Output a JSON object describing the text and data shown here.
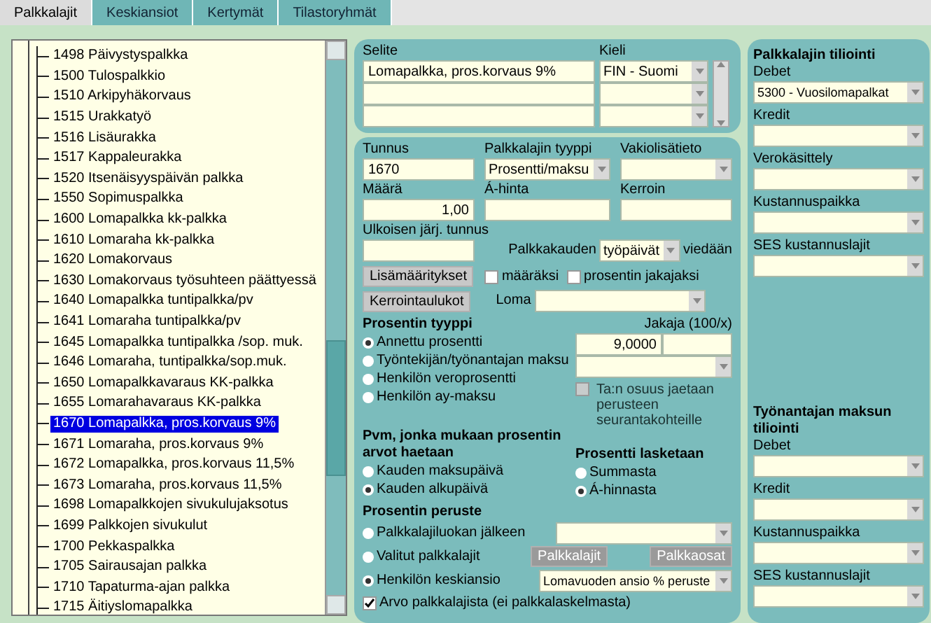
{
  "tabs": [
    {
      "label": "Palkkalajit",
      "selected": true
    },
    {
      "label": "Keskiansiot",
      "selected": false
    },
    {
      "label": "Kertymät",
      "selected": false
    },
    {
      "label": "Tilastoryhmät",
      "selected": false
    }
  ],
  "tree": {
    "items": [
      {
        "label": "1498 Päivystyspalkka",
        "selected": false
      },
      {
        "label": "1500 Tulospalkkio",
        "selected": false
      },
      {
        "label": "1510 Arkipyhäkorvaus",
        "selected": false
      },
      {
        "label": "1515 Urakkatyö",
        "selected": false
      },
      {
        "label": "1516 Lisäurakka",
        "selected": false
      },
      {
        "label": "1517 Kappaleurakka",
        "selected": false
      },
      {
        "label": "1520 Itsenäisyyspäivän palkka",
        "selected": false
      },
      {
        "label": "1550 Sopimuspalkka",
        "selected": false
      },
      {
        "label": "1600 Lomapalkka kk-palkka",
        "selected": false
      },
      {
        "label": "1610 Lomaraha kk-palkka",
        "selected": false
      },
      {
        "label": "1620 Lomakorvaus",
        "selected": false
      },
      {
        "label": "1630 Lomakorvaus työsuhteen päättyessä",
        "selected": false
      },
      {
        "label": "1640 Lomapalkka tuntipalkka/pv",
        "selected": false
      },
      {
        "label": "1641 Lomaraha tuntipalkka/pv",
        "selected": false
      },
      {
        "label": "1645 Lomapalkka tuntipalkka /sop. muk.",
        "selected": false
      },
      {
        "label": "1646 Lomaraha, tuntipalkka/sop.muk.",
        "selected": false
      },
      {
        "label": "1650 Lomapalkkavaraus KK-palkka",
        "selected": false
      },
      {
        "label": "1655 Lomarahavaraus KK-palkka",
        "selected": false
      },
      {
        "label": "1670 Lomapalkka, pros.korvaus 9%",
        "selected": true
      },
      {
        "label": "1671 Lomaraha, pros.korvaus 9%",
        "selected": false
      },
      {
        "label": "1672 Lomapalkka, pros.korvaus 11,5%",
        "selected": false
      },
      {
        "label": "1673 Lomaraha, pros.korvaus 11,5%",
        "selected": false
      },
      {
        "label": "1698 Lomapalkkojen sivukulujaksotus",
        "selected": false
      },
      {
        "label": "1699 Palkkojen sivukulut",
        "selected": false
      },
      {
        "label": "1700 Pekkaspalkka",
        "selected": false
      },
      {
        "label": "1705 Sairausajan palkka",
        "selected": false
      },
      {
        "label": "1710 Tapaturma-ajan palkka",
        "selected": false
      },
      {
        "label": "1715 Äitiyslomapalkka",
        "selected": false
      }
    ]
  },
  "descriptions": {
    "text_header": "Selite",
    "language_header": "Kieli",
    "rows": [
      {
        "text": "Lomapalkka, pros.korvaus 9%",
        "language": "FIN - Suomi"
      },
      {},
      {}
    ]
  },
  "fields": {
    "tunnus": {
      "label": "Tunnus",
      "value": "1670"
    },
    "tyyppi": {
      "label": "Palkkalajin tyyppi",
      "value": "Prosentti/maksu"
    },
    "vakiolisatieto": {
      "label": "Vakiolisätieto"
    },
    "maara": {
      "label": "Määrä",
      "value": "1,00"
    },
    "ahinta": {
      "label": "Á-hinta"
    },
    "kerroin": {
      "label": "Kerroin"
    },
    "ulkoinen": {
      "label": "Ulkoisen järj. tunnus"
    }
  },
  "period": {
    "label": "Palkkakauden",
    "value": "työpäivät",
    "suffix": "viedään"
  },
  "period_options": [
    {
      "label": "määräksi",
      "checked": false
    },
    {
      "label": "prosentin jakajaksi",
      "checked": false
    }
  ],
  "buttons": [
    {
      "label": "Lisämääritykset"
    },
    {
      "label": "Kerrointaulukot"
    }
  ],
  "loma": {
    "label": "Loma"
  },
  "percent_type": {
    "title": "Prosentin tyyppi",
    "divisor_label": "Jakaja (100/x)",
    "value": "9,0000",
    "options": [
      {
        "label": "Annettu prosentti",
        "selected": true
      },
      {
        "label": "Työntekijän/työnantajan maksu",
        "selected": false
      },
      {
        "label": "Henkilön veroprosentti",
        "selected": false
      },
      {
        "label": "Henkilön ay-maksu",
        "selected": false
      }
    ],
    "split": {
      "label": "Ta:n osuus jaetaan perusteen seurantakohteille",
      "checked": false,
      "disabled": true
    }
  },
  "date_basis": {
    "title": "Pvm, jonka mukaan prosentin arvot haetaan",
    "options": [
      {
        "label": "Kauden maksupäivä",
        "selected": false
      },
      {
        "label": "Kauden alkupäivä",
        "selected": true
      }
    ]
  },
  "calc_basis": {
    "title": "Prosentti lasketaan",
    "options": [
      {
        "label": "Summasta",
        "selected": false
      },
      {
        "label": "Á-hinnasta",
        "selected": true
      }
    ]
  },
  "percent_basis": {
    "title": "Prosentin peruste",
    "options": [
      {
        "kind": "select",
        "label": "Palkkalajiluokan jälkeen",
        "selected": false
      },
      {
        "kind": "buttons",
        "label": "Valitut palkkalajit",
        "selected": false,
        "buttons": [
          {
            "label": "Palkkalajit",
            "disabled": true
          },
          {
            "label": "Palkkaosat",
            "disabled": true
          }
        ]
      },
      {
        "kind": "select",
        "label": "Henkilön keskiansio",
        "selected": true,
        "value": "Lomavuoden ansio % peruste"
      }
    ],
    "from_wage_type": {
      "label": "Arvo palkkalajista (ei palkkalaskelmasta)",
      "checked": true
    }
  },
  "accounting": [
    {
      "title": "Palkkalajin tiliointi",
      "fields": [
        {
          "label": "Debet",
          "value": "5300 - Vuosilomapalkat"
        },
        {
          "label": "Kredit"
        },
        {
          "label": "Verokäsittely"
        },
        {
          "label": "Kustannuspaikka"
        },
        {
          "label": "SES kustannuslajit"
        }
      ]
    },
    {
      "title": "Työnantajan maksun tiliointi",
      "fields": [
        {
          "label": "Debet"
        },
        {
          "label": "Kredit"
        },
        {
          "label": "Kustannuspaikka"
        },
        {
          "label": "SES kustannuslajit"
        }
      ]
    }
  ]
}
